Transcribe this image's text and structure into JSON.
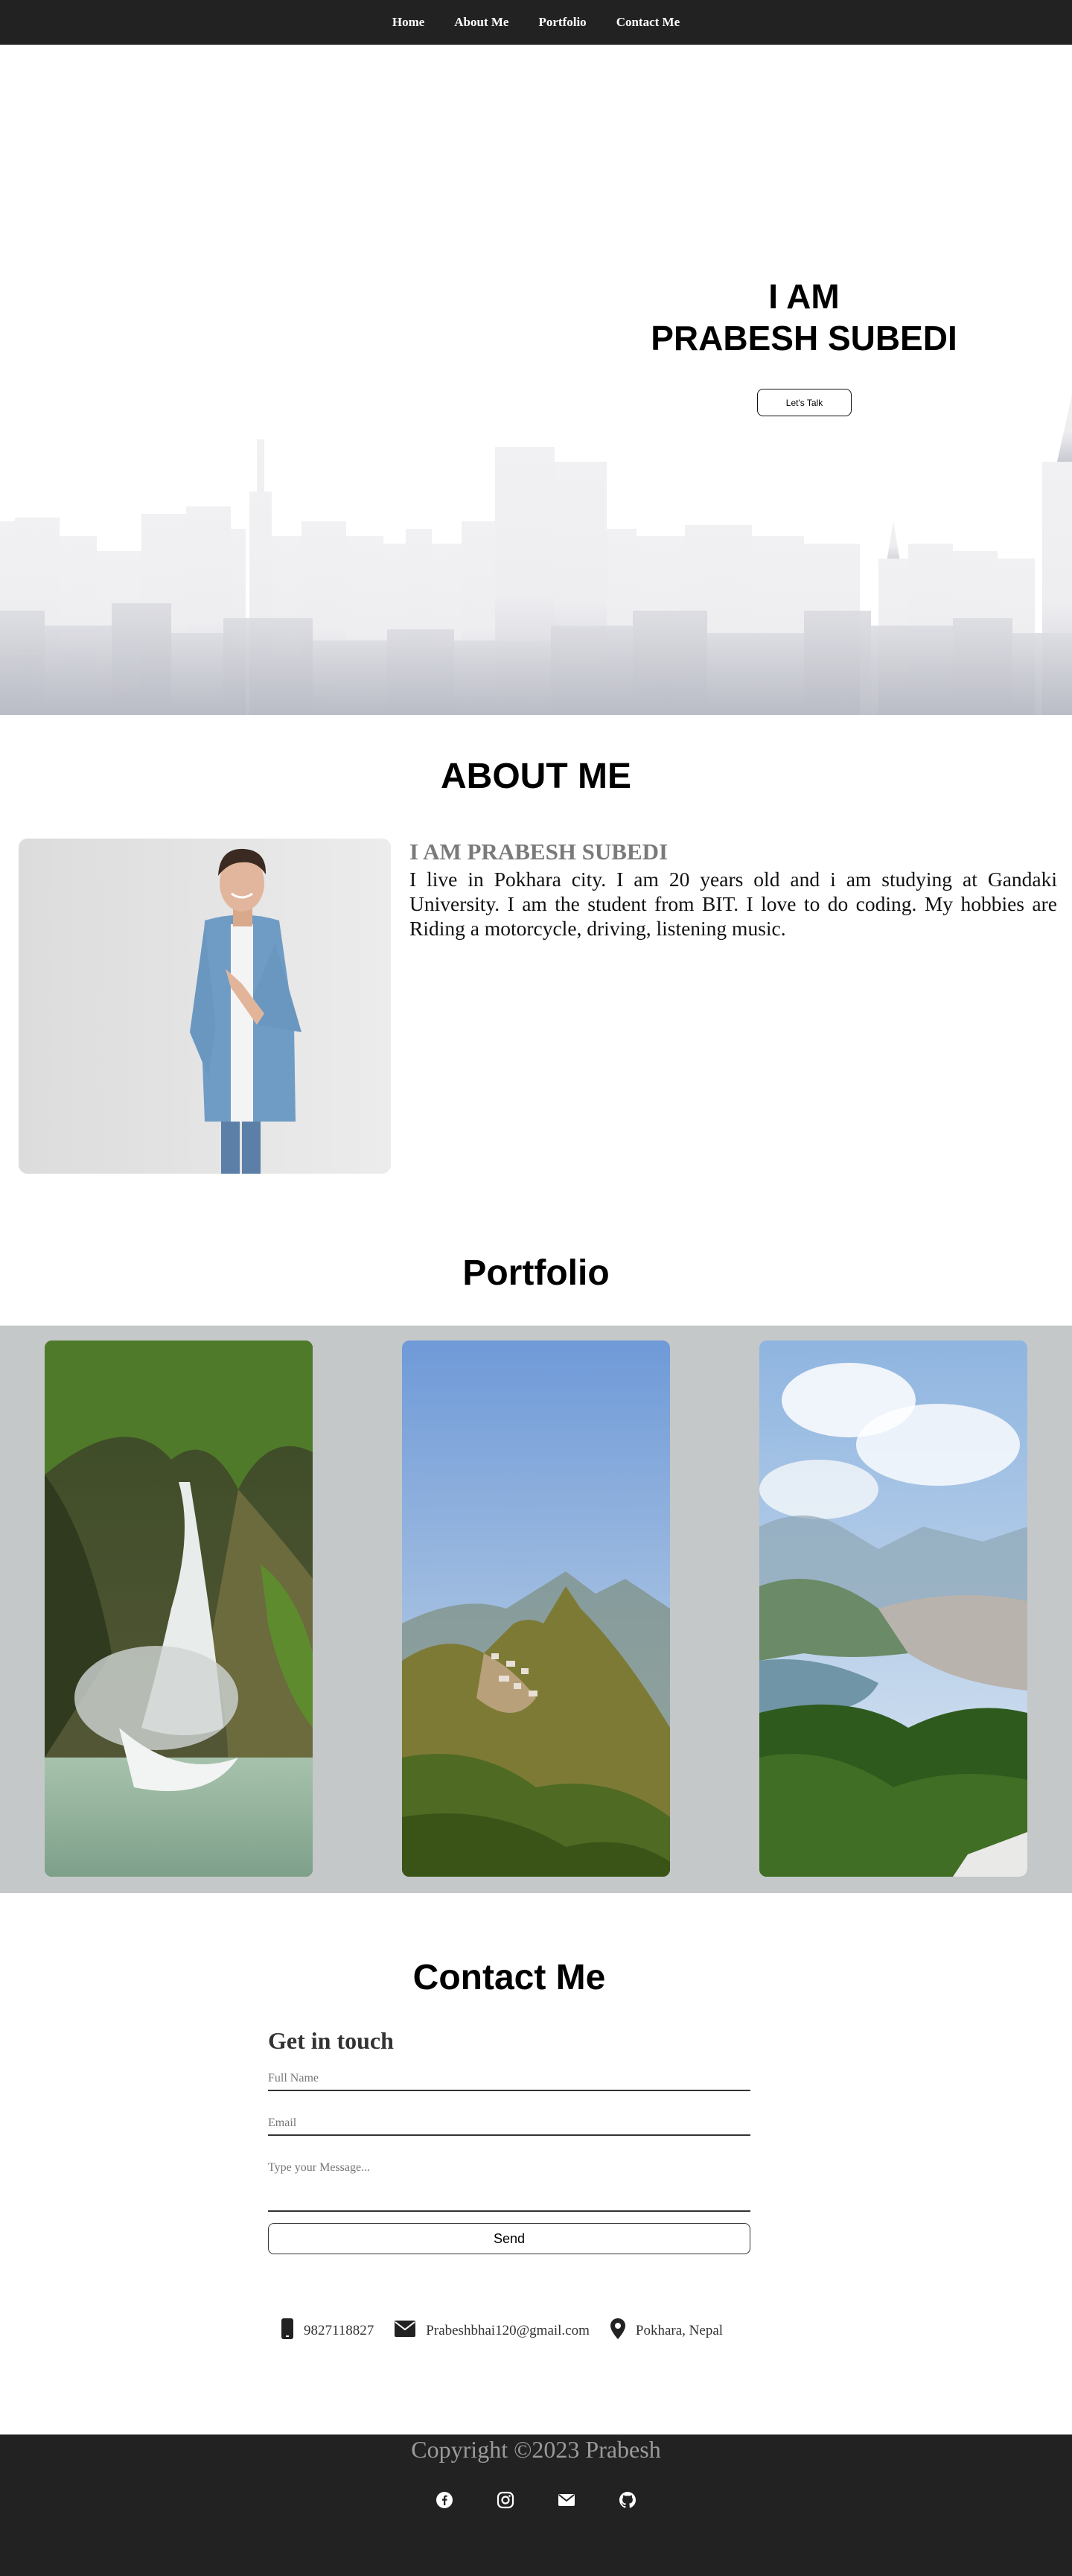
{
  "nav": {
    "items": [
      "Home",
      "About Me",
      "Portfolio",
      "Contact Me"
    ]
  },
  "hero": {
    "line1": "I AM",
    "line2": "PRABESH SUBEDI",
    "button": "Let's Talk"
  },
  "about": {
    "title": "ABOUT ME",
    "subtitle": "I AM PRABESH SUBEDI",
    "paragraph": "I live in Pokhara city. I am 20 years old and i am studying at Gandaki University. I am the student from BIT. I love to do coding. My hobbies are Riding a motorcycle, driving, listening music."
  },
  "portfolio": {
    "title": "Portfolio"
  },
  "contact": {
    "title": "Contact Me",
    "form_heading": "Get in touch",
    "full_name_placeholder": "Full Name",
    "email_placeholder": "Email",
    "message_placeholder": "Type your Message...",
    "send_label": "Send",
    "phone": "9827118827",
    "email": "Prabeshbhai120@gmail.com",
    "location": "Pokhara, Nepal"
  },
  "footer": {
    "copyright": "Copyright ©2023 Prabesh"
  },
  "colors": {
    "nav_bg": "#222222",
    "portfolio_band": "#c4c8c9",
    "subtitle_gray": "#7a7a7a",
    "footer_text": "#9a9a9a"
  }
}
